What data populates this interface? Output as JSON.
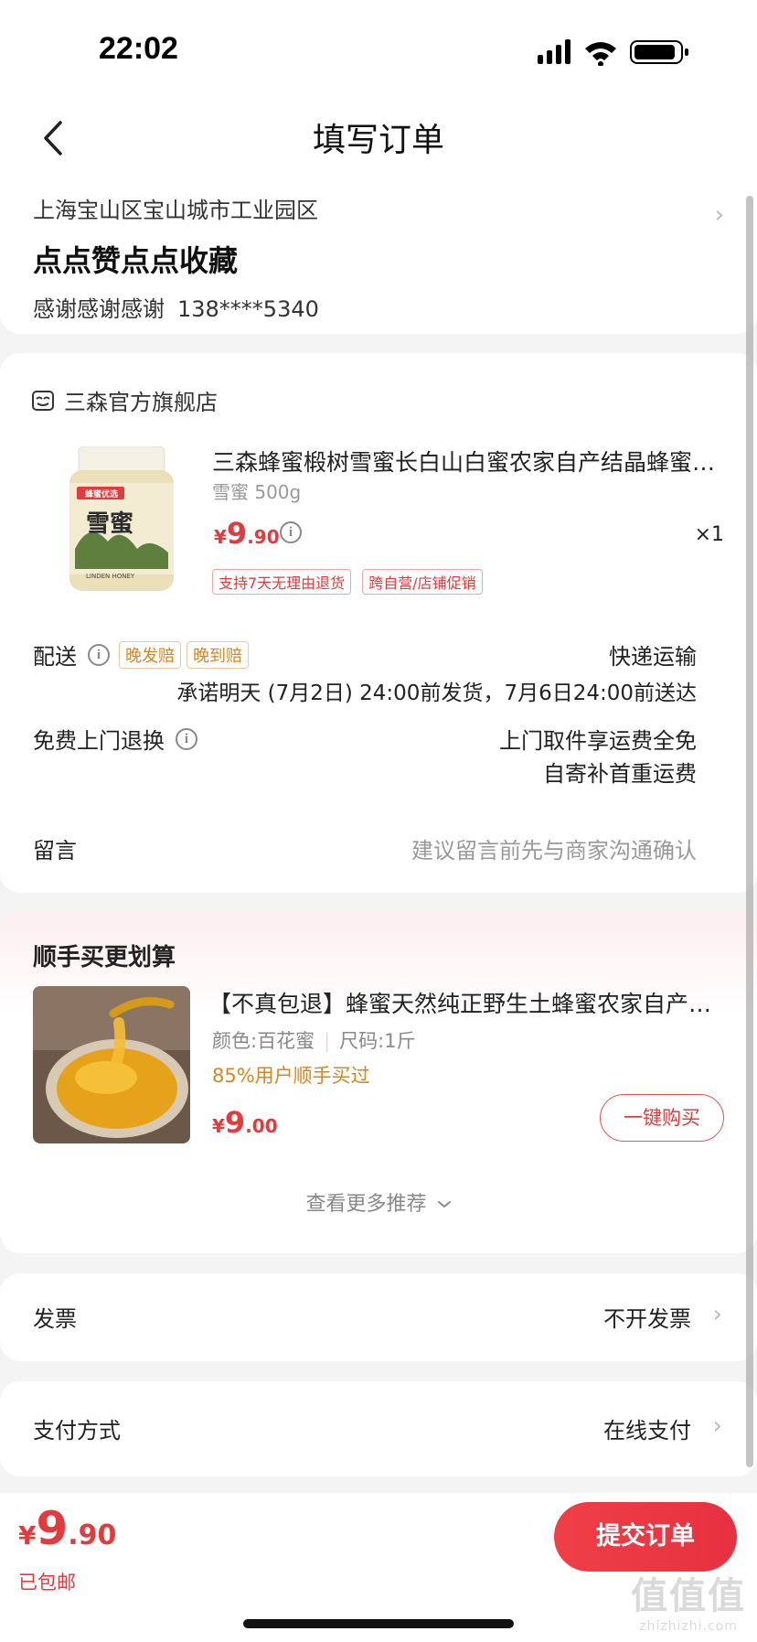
{
  "status_bar": {
    "time": "22:02"
  },
  "nav": {
    "title": "填写订单"
  },
  "address": {
    "line1": "上海宝山区宝山城市工业园区",
    "name": "点点赞点点收藏",
    "recipient": "感谢感谢感谢",
    "phone": "138****5340"
  },
  "store": {
    "name": "三森官方旗舰店"
  },
  "product": {
    "title": "三森蜂蜜椴树雪蜜长白山白蜜农家自产结晶蜂蜜纯正天然",
    "spec": "雪蜜 500g",
    "price_currency": "¥",
    "price_int": "9",
    "price_dec": ".90",
    "qty": "×1",
    "tags": [
      "支持7天无理由退货",
      "跨自营/店铺促销"
    ],
    "image_label_top": "蜂蜜优选",
    "image_label_main": "雪蜜",
    "image_label_sub": "LINDEN HONEY"
  },
  "delivery": {
    "label": "配送",
    "badges": [
      "晚发赔",
      "晚到赔"
    ],
    "method": "快递运输",
    "detail": "承诺明天 (7月2日) 24:00前发货，7月6日24:00前送达"
  },
  "return": {
    "label": "免费上门退换",
    "line1": "上门取件享运费全免",
    "line2": "自寄补首重运费"
  },
  "message": {
    "label": "留言",
    "placeholder": "建议留言前先与商家沟通确认"
  },
  "recommend": {
    "title": "顺手买更划算",
    "item_name": "【不真包退】蜂蜜天然纯正野生土蜂蜜农家自产正宗",
    "attr_color": "颜色:百花蜜",
    "attr_size": "尺码:1斤",
    "percent_text": "85%用户顺手买过",
    "price_currency": "¥",
    "price_int": "9",
    "price_dec": ".00",
    "buy_label": "一键购买",
    "more_label": "查看更多推荐"
  },
  "invoice": {
    "label": "发票",
    "value": "不开发票"
  },
  "payment": {
    "label": "支付方式",
    "value": "在线支付"
  },
  "footer": {
    "total_currency": "¥",
    "total_int": "9",
    "total_dec": ".90",
    "shipping_note": "已包邮",
    "submit_label": "提交订单"
  },
  "watermark": {
    "big": "值值值",
    "small": "zhizhizhi.com"
  },
  "colors": {
    "accent": "#e33b3b",
    "orange": "#d9851e",
    "muted": "#999999"
  }
}
